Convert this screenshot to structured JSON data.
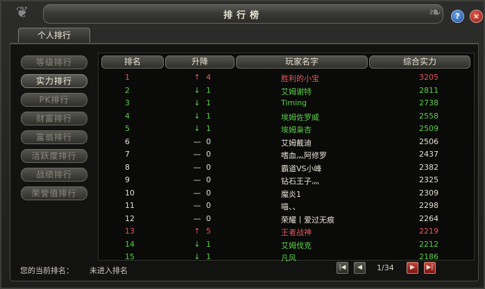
{
  "window": {
    "title": "排行榜"
  },
  "title_buttons": {
    "help": "?",
    "close": "×"
  },
  "tabs": [
    {
      "label": "个人排行"
    }
  ],
  "menu": [
    {
      "label": "等级排行",
      "active": false
    },
    {
      "label": "实力排行",
      "active": true
    },
    {
      "label": "PK排行",
      "active": false
    },
    {
      "label": "财富排行",
      "active": false
    },
    {
      "label": "富翁排行",
      "active": false
    },
    {
      "label": "活跃度排行",
      "active": false
    },
    {
      "label": "战绩排行",
      "active": false
    },
    {
      "label": "荣誉值排行",
      "active": false
    }
  ],
  "table": {
    "headers": {
      "rank": "排名",
      "change": "升降",
      "player": "玩家名字",
      "power": "综合实力"
    },
    "rows": [
      {
        "rank": "1",
        "arrow": "↑",
        "delta": "4",
        "name": "胜利的小宝",
        "power": "3205",
        "color": "#e05a5a"
      },
      {
        "rank": "2",
        "arrow": "↓",
        "delta": "1",
        "name": "艾姆谢特",
        "power": "2811",
        "color": "#5ccf4a"
      },
      {
        "rank": "3",
        "arrow": "↓",
        "delta": "1",
        "name": "Timing",
        "power": "2738",
        "color": "#5ccf4a"
      },
      {
        "rank": "4",
        "arrow": "↓",
        "delta": "1",
        "name": "埃姆佐罗威",
        "power": "2558",
        "color": "#5ccf4a"
      },
      {
        "rank": "5",
        "arrow": "↓",
        "delta": "1",
        "name": "埃姆枭杏",
        "power": "2509",
        "color": "#5ccf4a"
      },
      {
        "rank": "6",
        "arrow": "—",
        "delta": "0",
        "name": "艾姆戴迪",
        "power": "2506",
        "color": "#e4e0d4"
      },
      {
        "rank": "7",
        "arrow": "—",
        "delta": "0",
        "name": "嗜血灬阿修罗",
        "power": "2437",
        "color": "#e4e0d4"
      },
      {
        "rank": "8",
        "arrow": "—",
        "delta": "0",
        "name": "霸道VS小峰",
        "power": "2382",
        "color": "#e4e0d4"
      },
      {
        "rank": "9",
        "arrow": "—",
        "delta": "0",
        "name": "钻石王子灬",
        "power": "2325",
        "color": "#e4e0d4"
      },
      {
        "rank": "10",
        "arrow": "—",
        "delta": "0",
        "name": "魔炎1",
        "power": "2309",
        "color": "#e4e0d4"
      },
      {
        "rank": "11",
        "arrow": "—",
        "delta": "0",
        "name": "喵、、",
        "power": "2298",
        "color": "#e4e0d4"
      },
      {
        "rank": "12",
        "arrow": "—",
        "delta": "0",
        "name": "荣耀丨爱过无痕",
        "power": "2264",
        "color": "#e4e0d4"
      },
      {
        "rank": "13",
        "arrow": "↑",
        "delta": "5",
        "name": "王者战神",
        "power": "2219",
        "color": "#e05a5a"
      },
      {
        "rank": "14",
        "arrow": "↓",
        "delta": "1",
        "name": "艾姆伐克",
        "power": "2212",
        "color": "#5ccf4a"
      },
      {
        "rank": "15",
        "arrow": "↓",
        "delta": "1",
        "name": "凡风",
        "power": "2186",
        "color": "#5ccf4a"
      }
    ]
  },
  "footer": {
    "current_rank_label": "您的当前排名：",
    "current_rank_value": "未进入排名",
    "page_indicator": "1/34"
  },
  "icons": {
    "first": "first-page-icon",
    "prev": "prev-page-icon",
    "next": "next-page-icon",
    "last": "last-page-icon"
  },
  "colors": {
    "rise": "#e05a5a",
    "fall": "#5ccf4a",
    "flat": "#e4e0d4"
  }
}
